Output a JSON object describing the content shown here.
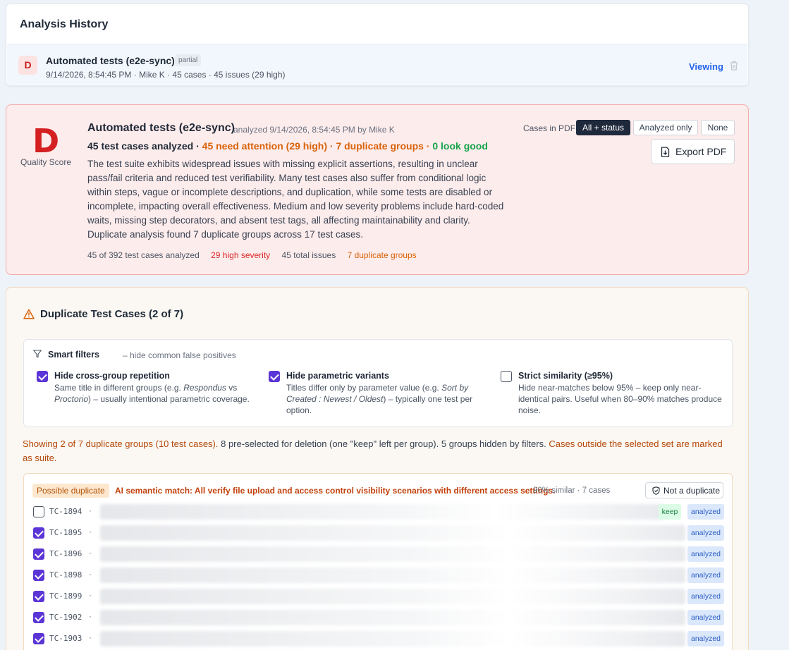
{
  "history": {
    "title": "Analysis History",
    "entry": {
      "grade": "D",
      "name": "Automated tests (e2e-sync)",
      "tag": "partial",
      "meta": "9/14/2026, 8:54:45 PM · Mike K · 45 cases · 45 issues (29 high)",
      "status": "Viewing"
    }
  },
  "summary": {
    "grade": "D",
    "grade_label": "Quality Score",
    "title": "Automated tests (e2e-sync)",
    "analyzed": "analyzed 9/14/2026, 8:54:45 PM by Mike K",
    "line": {
      "cases": "45 test cases analyzed · ",
      "attention": "45 need attention (29 high) · ",
      "dup_groups": "7 duplicate groups · ",
      "good": "0 look good"
    },
    "description": "The test suite exhibits widespread issues with missing explicit assertions, resulting in unclear pass/fail criteria and reduced test verifiability. Many test cases also suffer from conditional logic within steps, vague or incomplete descriptions, and duplication, while some tests are disabled or incomplete, impacting overall effectiveness. Medium and low severity problems include hard-coded waits, missing step decorators, and absent test tags, all affecting maintainability and clarity. Duplicate analysis found 7 duplicate groups across 17 test cases.",
    "stats": {
      "analyzed": "45 of 392 test cases analyzed",
      "high": "29 high severity",
      "total": "45 total issues",
      "dups": "7 duplicate groups"
    },
    "pdf": {
      "label": "Cases in PDF:",
      "options": [
        "All + status",
        "Analyzed only",
        "None"
      ],
      "selected": "All + status",
      "export": "Export PDF"
    }
  },
  "duplicates": {
    "title": "Duplicate Test Cases (2 of 7)",
    "filters": {
      "heading": "Smart filters",
      "subheading": "– hide common false positives",
      "items": [
        {
          "title": "Hide cross-group repetition",
          "checked": true,
          "desc_a": "Same title in different groups (e.g. ",
          "desc_i1": "Respondus",
          "desc_b": " vs ",
          "desc_i2": "Proctorio",
          "desc_c": ") – usually intentional parametric coverage."
        },
        {
          "title": "Hide parametric variants",
          "checked": true,
          "desc_a": "Titles differ only by parameter value (e.g. ",
          "desc_i1": "Sort by Created : Newest / Oldest",
          "desc_b": ") – typically one test per option."
        },
        {
          "title": "Strict similarity (≥95%)",
          "checked": false,
          "desc": "Hide near-matches below 95% – keep only near-identical pairs. Useful when 80–90% matches produce noise."
        }
      ]
    },
    "showing": {
      "a": "Showing 2 of 7 duplicate groups (10 test cases).",
      "b": " 8 pre-selected for deletion (one \"keep\" left per group). 5 groups hidden by filters. ",
      "c": "Cases outside the selected set are marked as suite."
    },
    "group": {
      "badge": "Possible duplicate",
      "description": "AI semantic match: All verify file upload and access control visibility scenarios with different access settings.",
      "similarity": "90% similar · 7 cases",
      "not_dup": "Not a duplicate",
      "rows": [
        {
          "id": "TC-1894",
          "checked": false,
          "keep": "keep",
          "status": "analyzed"
        },
        {
          "id": "TC-1895",
          "checked": true,
          "status": "analyzed"
        },
        {
          "id": "TC-1896",
          "checked": true,
          "status": "analyzed"
        },
        {
          "id": "TC-1898",
          "checked": true,
          "status": "analyzed"
        },
        {
          "id": "TC-1899",
          "checked": true,
          "status": "analyzed"
        },
        {
          "id": "TC-1902",
          "checked": true,
          "status": "analyzed"
        },
        {
          "id": "TC-1903",
          "checked": true,
          "status": "analyzed"
        }
      ]
    }
  },
  "colors": {
    "accent_purple": "#5b35d5",
    "danger": "#d42020",
    "warning": "#d9620a",
    "success": "#16a34a",
    "link": "#2563eb"
  },
  "icons": [
    "trash-icon",
    "download-file-icon",
    "warning-triangle-icon",
    "funnel-icon",
    "shield-check-icon"
  ]
}
